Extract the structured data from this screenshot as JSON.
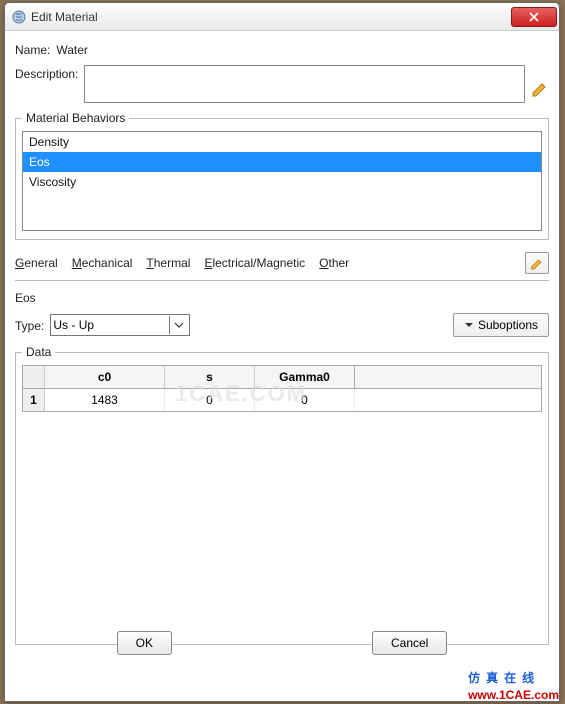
{
  "window": {
    "title": "Edit Material"
  },
  "fields": {
    "name_label": "Name:",
    "name_value": "Water",
    "description_label": "Description:",
    "description_value": ""
  },
  "behaviors": {
    "legend": "Material Behaviors",
    "items": [
      "Density",
      "Eos",
      "Viscosity"
    ],
    "selected_index": 1
  },
  "tabs": {
    "general": "General",
    "mechanical": "Mechanical",
    "thermal": "Thermal",
    "electrical": "Electrical/Magnetic",
    "other": "Other"
  },
  "section": {
    "name": "Eos",
    "type_label": "Type:",
    "type_value": "Us - Up",
    "suboptions_label": "Suboptions"
  },
  "data_grid": {
    "legend": "Data",
    "columns": [
      "c0",
      "s",
      "Gamma0"
    ],
    "rows": [
      {
        "index": "1",
        "values": [
          "1483",
          "0",
          "0"
        ]
      }
    ]
  },
  "buttons": {
    "ok": "OK",
    "cancel": "Cancel"
  },
  "watermark": {
    "center": "1CAE.COM",
    "cn": "仿真在线",
    "url": "www.1CAE.com"
  }
}
